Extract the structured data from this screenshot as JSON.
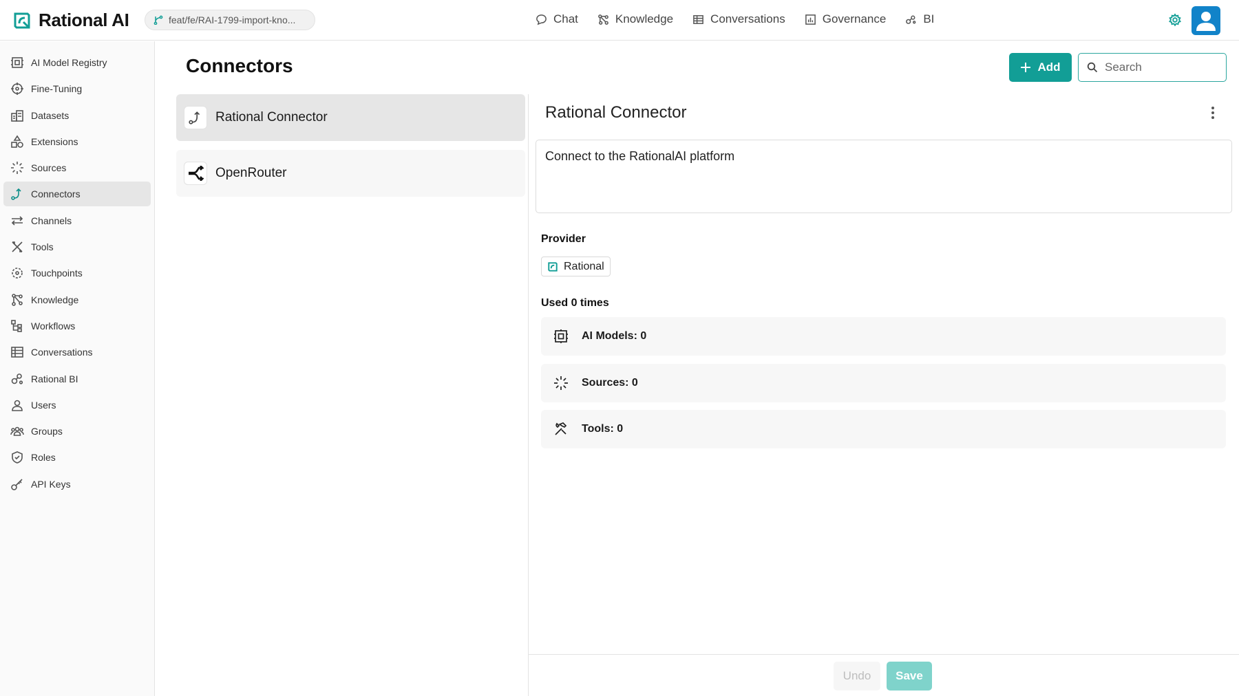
{
  "app": {
    "name": "Rational AI",
    "branch": "feat/fe/RAI-1799-import-kno..."
  },
  "topnav": [
    {
      "label": "Chat",
      "icon": "chat-bubble-icon"
    },
    {
      "label": "Knowledge",
      "icon": "knowledge-graph-icon"
    },
    {
      "label": "Conversations",
      "icon": "table-icon"
    },
    {
      "label": "Governance",
      "icon": "bar-chart-icon"
    },
    {
      "label": "BI",
      "icon": "bi-nodes-icon"
    }
  ],
  "sidebar": {
    "items": [
      {
        "label": "AI Model Registry",
        "icon": "chip-icon"
      },
      {
        "label": "Fine-Tuning",
        "icon": "crosshair-icon"
      },
      {
        "label": "Datasets",
        "icon": "datasets-icon"
      },
      {
        "label": "Extensions",
        "icon": "shapes-icon"
      },
      {
        "label": "Sources",
        "icon": "loader-icon"
      },
      {
        "label": "Connectors",
        "icon": "connector-icon",
        "active": true
      },
      {
        "label": "Channels",
        "icon": "arrows-left-right-icon"
      },
      {
        "label": "Tools",
        "icon": "tools-icon"
      },
      {
        "label": "Touchpoints",
        "icon": "touchpoint-icon"
      },
      {
        "label": "Knowledge",
        "icon": "knowledge-graph-icon"
      },
      {
        "label": "Workflows",
        "icon": "workflow-icon"
      },
      {
        "label": "Conversations",
        "icon": "table-icon"
      },
      {
        "label": "Rational BI",
        "icon": "bi-nodes-icon"
      },
      {
        "label": "Users",
        "icon": "user-icon"
      },
      {
        "label": "Groups",
        "icon": "group-icon"
      },
      {
        "label": "Roles",
        "icon": "shield-check-icon"
      },
      {
        "label": "API Keys",
        "icon": "key-icon"
      }
    ]
  },
  "page": {
    "title": "Connectors",
    "add_label": "Add",
    "search_placeholder": "Search"
  },
  "connectors": [
    {
      "label": "Rational Connector",
      "icon": "connector-icon",
      "selected": true
    },
    {
      "label": "OpenRouter",
      "icon": "openrouter-logo-icon",
      "selected": false
    }
  ],
  "detail": {
    "title": "Rational Connector",
    "description": "Connect to the RationalAI platform",
    "provider_label": "Provider",
    "provider_name": "Rational",
    "used_label": "Used 0 times",
    "usage": [
      {
        "label": "AI Models: 0",
        "icon": "chip-icon"
      },
      {
        "label": "Sources: 0",
        "icon": "loader-icon"
      },
      {
        "label": "Tools: 0",
        "icon": "hammer-wrench-icon"
      }
    ]
  },
  "footer": {
    "undo_label": "Undo",
    "save_label": "Save"
  },
  "colors": {
    "accent": "#129e96",
    "accent_light": "#7fd3cb",
    "avatar": "#1183c9"
  }
}
